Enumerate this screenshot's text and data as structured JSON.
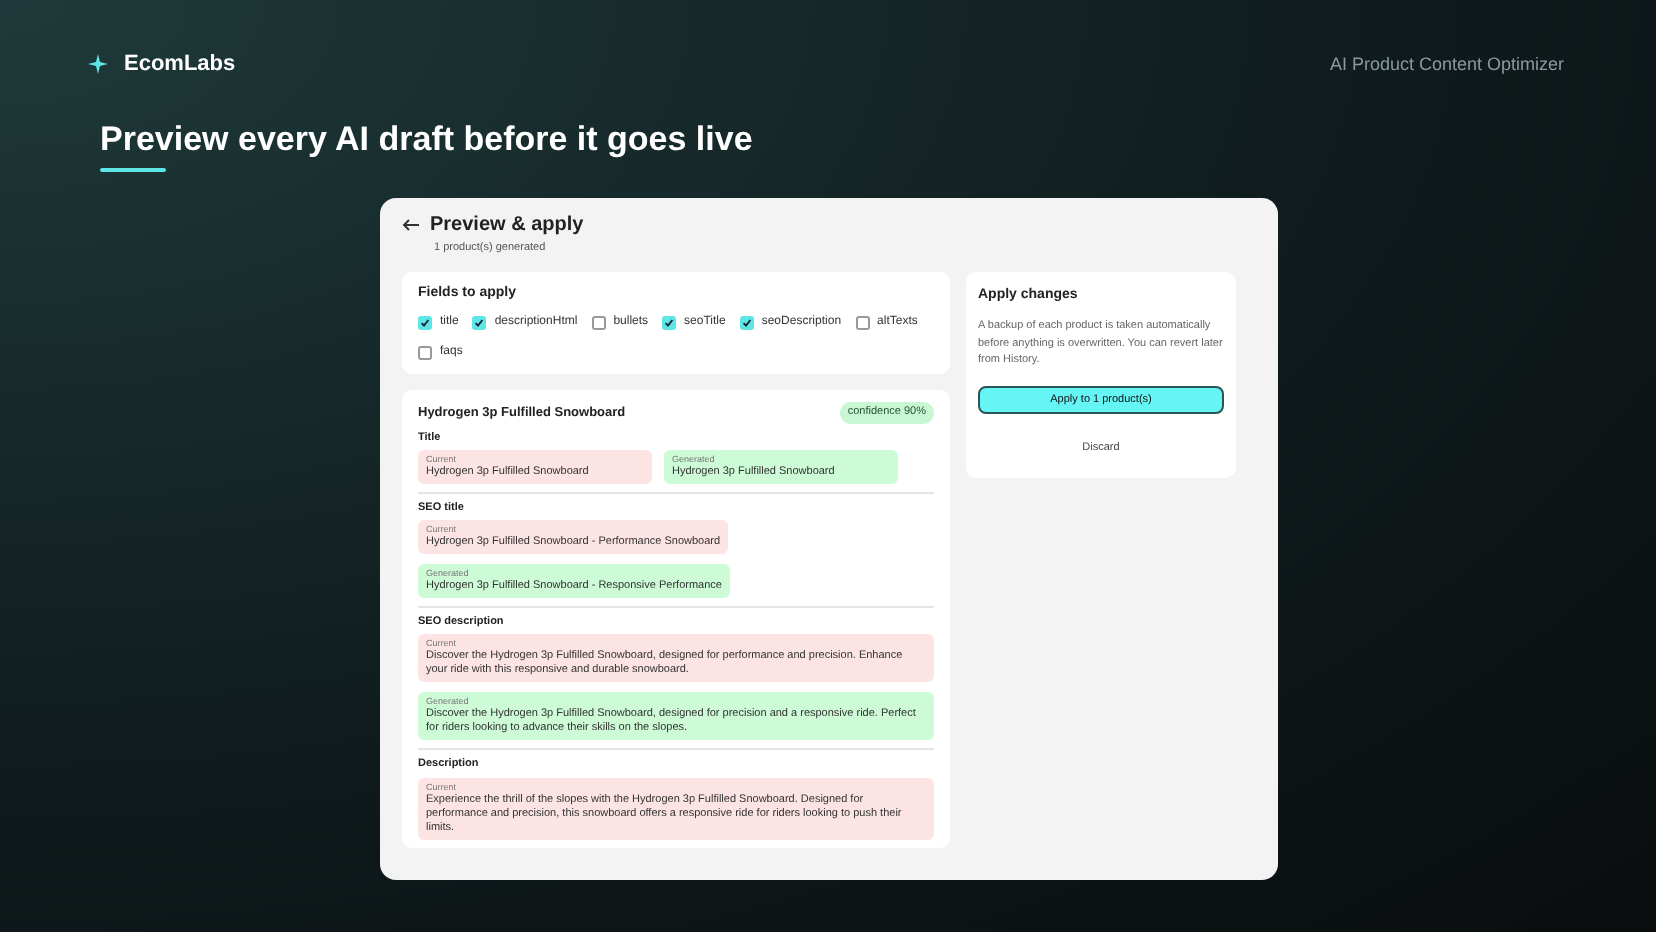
{
  "brand": {
    "name": "EcomLabs",
    "tagline": "AI Product Content Optimizer"
  },
  "headline": "Preview every AI draft before it goes live",
  "app": {
    "title": "Preview & apply",
    "subtitle": "1 product(s) generated",
    "fields": {
      "heading": "Fields to apply",
      "items": [
        {
          "label": "title",
          "checked": true
        },
        {
          "label": "descriptionHtml",
          "checked": true
        },
        {
          "label": "bullets",
          "checked": false
        },
        {
          "label": "seoTitle",
          "checked": true
        },
        {
          "label": "seoDescription",
          "checked": true
        },
        {
          "label": "altTexts",
          "checked": false
        },
        {
          "label": "faqs",
          "checked": false
        }
      ]
    },
    "product": {
      "name": "Hydrogen 3p Fulfilled Snowboard",
      "confidence": "confidence 90%",
      "sections": [
        {
          "kind": "row",
          "label": "Title",
          "entries": [
            {
              "tag": "Current",
              "text": "Hydrogen 3p Fulfilled Snowboard",
              "kind": "current"
            },
            {
              "tag": "Generated",
              "text": "Hydrogen 3p Fulfilled Snowboard",
              "kind": "generated"
            }
          ]
        },
        {
          "kind": "stack",
          "label": "SEO title",
          "entries": [
            {
              "tag": "Current",
              "text": "Hydrogen 3p Fulfilled Snowboard - Performance Snowboard",
              "kind": "current"
            },
            {
              "tag": "Generated",
              "text": "Hydrogen 3p Fulfilled Snowboard - Responsive Performance",
              "kind": "generated"
            }
          ]
        },
        {
          "kind": "wide",
          "label": "SEO description",
          "entries": [
            {
              "tag": "Current",
              "text": "Discover the Hydrogen 3p Fulfilled Snowboard, designed for performance and precision. Enhance your ride with this responsive and durable snowboard.",
              "kind": "current"
            },
            {
              "tag": "Generated",
              "text": "Discover the Hydrogen 3p Fulfilled Snowboard, designed for precision and a responsive ride. Perfect for riders looking to advance their skills on the slopes.",
              "kind": "generated"
            }
          ]
        },
        {
          "kind": "wide",
          "label": "Description",
          "entries": [
            {
              "tag": "Current",
              "text": "Experience the thrill of the slopes with the Hydrogen 3p Fulfilled Snowboard. Designed for performance and precision, this snowboard offers a responsive ride for riders looking to push their limits.",
              "kind": "current"
            }
          ]
        }
      ]
    },
    "apply": {
      "heading": "Apply changes",
      "note": "A backup of each product is taken automatically before anything is overwritten. You can revert later from History.",
      "primary": "Apply to 1 product(s)",
      "secondary": "Discard"
    }
  }
}
